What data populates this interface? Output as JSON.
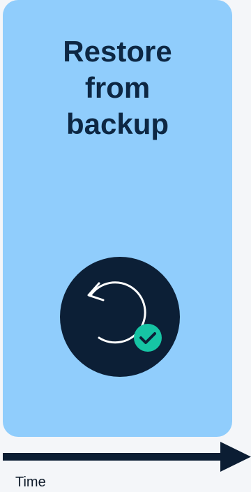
{
  "card": {
    "title": "Restore\nfrom\nbackup",
    "icon": "restore-with-check-icon",
    "background_color": "#90cdfc",
    "title_color": "#0d2743"
  },
  "icon_colors": {
    "circle": "#0c1f36",
    "arrow": "#ffffff",
    "check_badge": "#16c4a4"
  },
  "timeline": {
    "label": "Time",
    "arrow_color": "#0b1d33"
  }
}
